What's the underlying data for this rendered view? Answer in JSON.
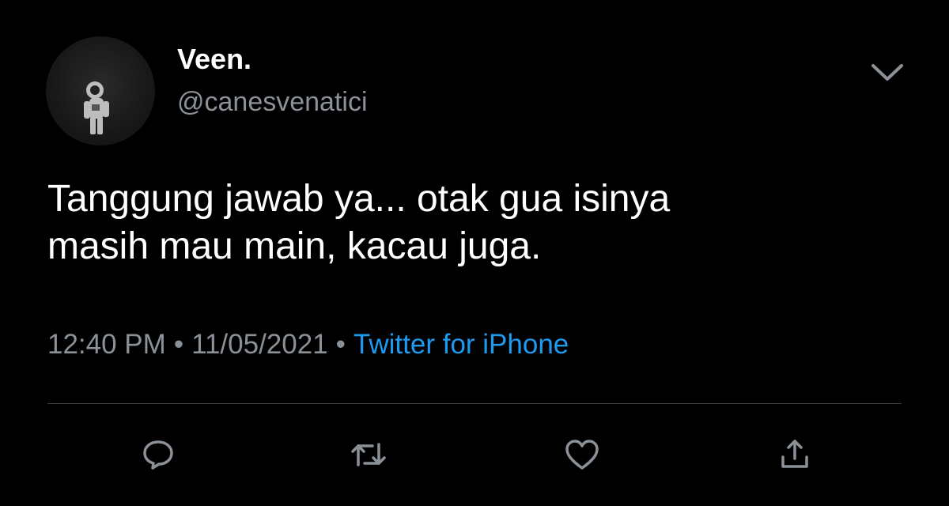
{
  "tweet": {
    "user": {
      "display_name": "Veen.",
      "handle": "@canesvenatici",
      "avatar_icon": "astronaut-avatar"
    },
    "text_lines": [
      "Tanggung jawab ya... otak gua isinya",
      "masih mau main, kacau juga."
    ],
    "time": "12:40 PM",
    "date": "11/05/2021",
    "separator": "•",
    "source": "Twitter for iPhone",
    "more_icon": "chevron-down-icon"
  },
  "actions": [
    {
      "icon": "reply-icon"
    },
    {
      "icon": "retweet-icon"
    },
    {
      "icon": "like-icon"
    },
    {
      "icon": "share-icon"
    }
  ],
  "colors": {
    "background": "#000000",
    "text": "#ffffff",
    "secondary": "#8b9197",
    "link": "#1d9bf0",
    "divider": "#3b3f44"
  }
}
